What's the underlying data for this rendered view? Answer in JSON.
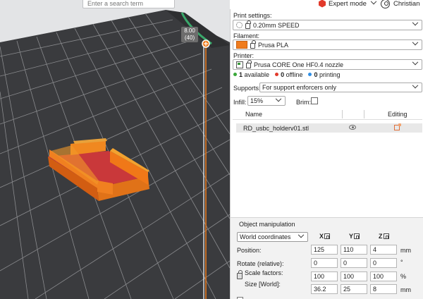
{
  "search": {
    "placeholder": "Enter a search term"
  },
  "viewport": {
    "layer_height": "8.00",
    "layer_number": "(40)"
  },
  "mode": {
    "label": "Expert mode",
    "icon": "hexagon-icon",
    "color": "#e23a2b"
  },
  "user": {
    "name": "Christian",
    "icon": "user-icon"
  },
  "print_settings": {
    "label": "Print settings:",
    "value": "0.20mm SPEED"
  },
  "filament": {
    "label": "Filament:",
    "value": "Prusa PLA",
    "color": "#f07c1d"
  },
  "printer": {
    "label": "Printer:",
    "value": "Prusa CORE One HF0.4 nozzle"
  },
  "printer_status": [
    {
      "count": "1",
      "text": "available",
      "color": "#3aa83a"
    },
    {
      "count": "0",
      "text": "offline",
      "color": "#e23a2b"
    },
    {
      "count": "0",
      "text": "printing",
      "color": "#2f8fe6"
    }
  ],
  "supports": {
    "label": "Supports:",
    "value": "For support enforcers only"
  },
  "infill": {
    "label": "Infill:",
    "value": "15%"
  },
  "brim": {
    "label": "Brim:"
  },
  "object_list": {
    "col_name": "Name",
    "col_editing": "Editing",
    "rows": [
      {
        "name": "RD_usbc_holderv01.stl"
      }
    ]
  },
  "object_manipulation": {
    "title": "Object manipulation",
    "coord_system": "World coordinates",
    "axes": [
      "X",
      "Y",
      "Z"
    ],
    "position": {
      "label": "Position:",
      "values": [
        "125",
        "110",
        "4"
      ],
      "unit": "mm"
    },
    "rotate": {
      "label": "Rotate (relative):",
      "values": [
        "0",
        "0",
        "0"
      ],
      "unit": "°"
    },
    "scale": {
      "label": "Scale factors:",
      "values": [
        "100",
        "100",
        "100"
      ],
      "unit": "%"
    },
    "size": {
      "label": "Size [World]:",
      "values": [
        "36.2",
        "25",
        "8"
      ],
      "unit": "mm"
    }
  }
}
